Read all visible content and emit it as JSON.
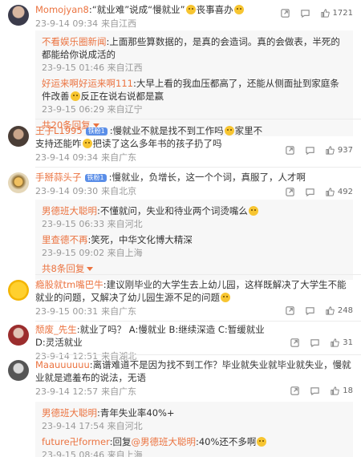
{
  "comments": [
    {
      "user": "Momojyan8",
      "badge": "",
      "text": ":“就业难”说成“慢就业”",
      "text_after": "丧事喜办",
      "meta_time": "23-9-14 09:34",
      "meta_loc": "来自江西",
      "avatar_icon": "avatar-1",
      "replies": [
        {
          "user": "不看娱乐圈新闻",
          "text": ":上面那些算数据的，是真的会造词。真的会做表，半死的都能给你说成活的",
          "time": "23-9-15 01:46",
          "loc": "来自江西"
        },
        {
          "user": "好运来啊好运来啊111",
          "text": ":大早上看的我血压都高了，还能从侧面扯到家庭条件改善",
          "text_after": "反正在说右说都是赢",
          "time": "23-9-15 06:29",
          "loc": "来自辽宁"
        }
      ],
      "more": "共20条回复",
      "stats": {
        "share": "",
        "comment": "",
        "like": "1721"
      }
    },
    {
      "user": "王子L1995",
      "badge": "铁粉1",
      "text": ":慢就业不就是找不到工作吗",
      "text_after": "家里不支持还能咋",
      "text_after2": "把读了这么多年书的孩子扔了吗",
      "meta_time": "23-9-14 09:34",
      "meta_loc": "来自广东",
      "stats": {
        "like": "937"
      }
    },
    {
      "user": "手掰蒜头子",
      "badge": "铁粉1",
      "text": ":慢就业，负增长，这一个个词，真服了，人才啊",
      "meta_time": "23-9-14 09:30",
      "meta_loc": "来自北京",
      "replies": [
        {
          "user": "男德班大聪明",
          "text": ":不懂就问，失业和待业两个词烫嘴么",
          "time": "23-9-15 06:33",
          "loc": "来自河北"
        },
        {
          "user": "里查德不再",
          "text": ":笑死，中华文化博大精深",
          "time": "23-9-15 09:02",
          "loc": "来自上海"
        }
      ],
      "more": "共8条回复",
      "stats": {
        "like": "492"
      }
    },
    {
      "user": "瘾股就tm嘴巴牛",
      "badge": "",
      "text": ":建议刚毕业的大学生去上幼儿园，这样既解决了大学生不能就业的问题，又解决了幼儿园生源不足的问题",
      "meta_time": "23-9-15 00:31",
      "meta_loc": "来自广东",
      "stats": {
        "like": "248"
      }
    },
    {
      "user": "颓废_先生",
      "badge": "",
      "text": ":就业了吗？ A:慢就业 B:继续深造 C:暂缓就业 D:灵活就业",
      "meta_time": "23-9-14 12:51",
      "meta_loc": "来自湖北",
      "stats": {
        "like": "31"
      }
    },
    {
      "user": "Maauuuuuu",
      "badge": "",
      "text": ":离谱难道不是因为找不到工作？毕业就失业就毕业就失业，慢就业就是遮羞布的说法，无语",
      "meta_time": "23-9-14 12:57",
      "meta_loc": "来自广东",
      "replies": [
        {
          "user": "男德班大聪明",
          "text": ":青年失业率40%+",
          "time": "23-9-14 17:54",
          "loc": "来自河北"
        },
        {
          "user": "future卍former",
          "text": ":回复",
          "mention": "@男德班大聪明",
          "text_tail": ":40%还不多啊",
          "time": "23-9-15 08:46",
          "loc": "来自上海"
        }
      ],
      "stats": {
        "like": "18"
      }
    }
  ],
  "colors": {
    "username": "#eb7340",
    "badge": "#5a8ee8",
    "meta": "#999999",
    "reply_bg": "#f7f7f7",
    "emoji": "#f7c531"
  }
}
